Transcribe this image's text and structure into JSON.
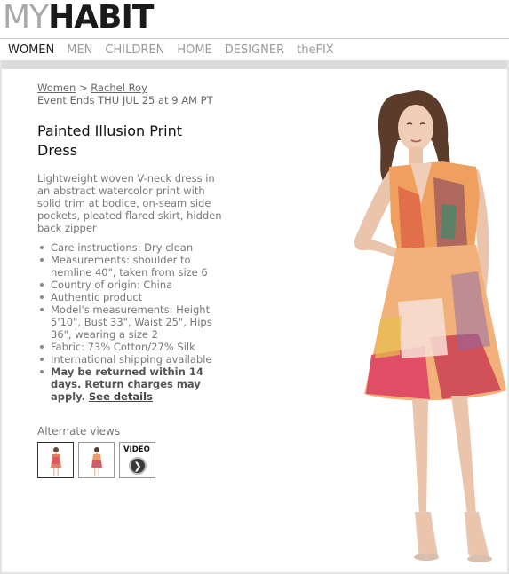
{
  "logo": {
    "my": "MY",
    "habit": "HABIT"
  },
  "nav": {
    "items": [
      {
        "label": "WOMEN",
        "active": true
      },
      {
        "label": "MEN",
        "active": false
      },
      {
        "label": "CHILDREN",
        "active": false
      },
      {
        "label": "HOME",
        "active": false
      },
      {
        "label": "DESIGNER",
        "active": false
      },
      {
        "label": "theFIX",
        "active": false
      }
    ]
  },
  "breadcrumb": {
    "parent": "Women",
    "separator": ">",
    "current": "Rachel Roy"
  },
  "event_ends": "Event Ends THU JUL 25 at 9 AM PT",
  "product": {
    "title_line1": "Painted Illusion Print",
    "title_line2": "Dress",
    "description": "Lightweight woven V-neck dress in an abstract watercolor print with solid trim at bodice, on-seam side pockets, pleated flared skirt, hidden back zipper",
    "details": [
      "Care instructions: Dry clean",
      "Measurements: shoulder to hemline 40\", taken from size 6",
      "Country of origin: China",
      "Authentic product",
      "Model's measurements: Height 5'10\", Bust 33\", Waist 25\", Hips 36\", wearing a size 2",
      "Fabric: 73% Cotton/27% Silk",
      "International shipping available"
    ],
    "returns_text": "May be returned within 14 days. Return charges may apply.",
    "returns_link": "See details"
  },
  "alternate_views": {
    "label": "Alternate views",
    "video_label": "VIDEO",
    "play_icon": "play-chevron-icon"
  },
  "colors": {
    "nav_active": "#222222",
    "nav_inactive": "#9a9a9a",
    "logo_grey": "#a9a9a9",
    "logo_dark": "#1a1a1a"
  }
}
